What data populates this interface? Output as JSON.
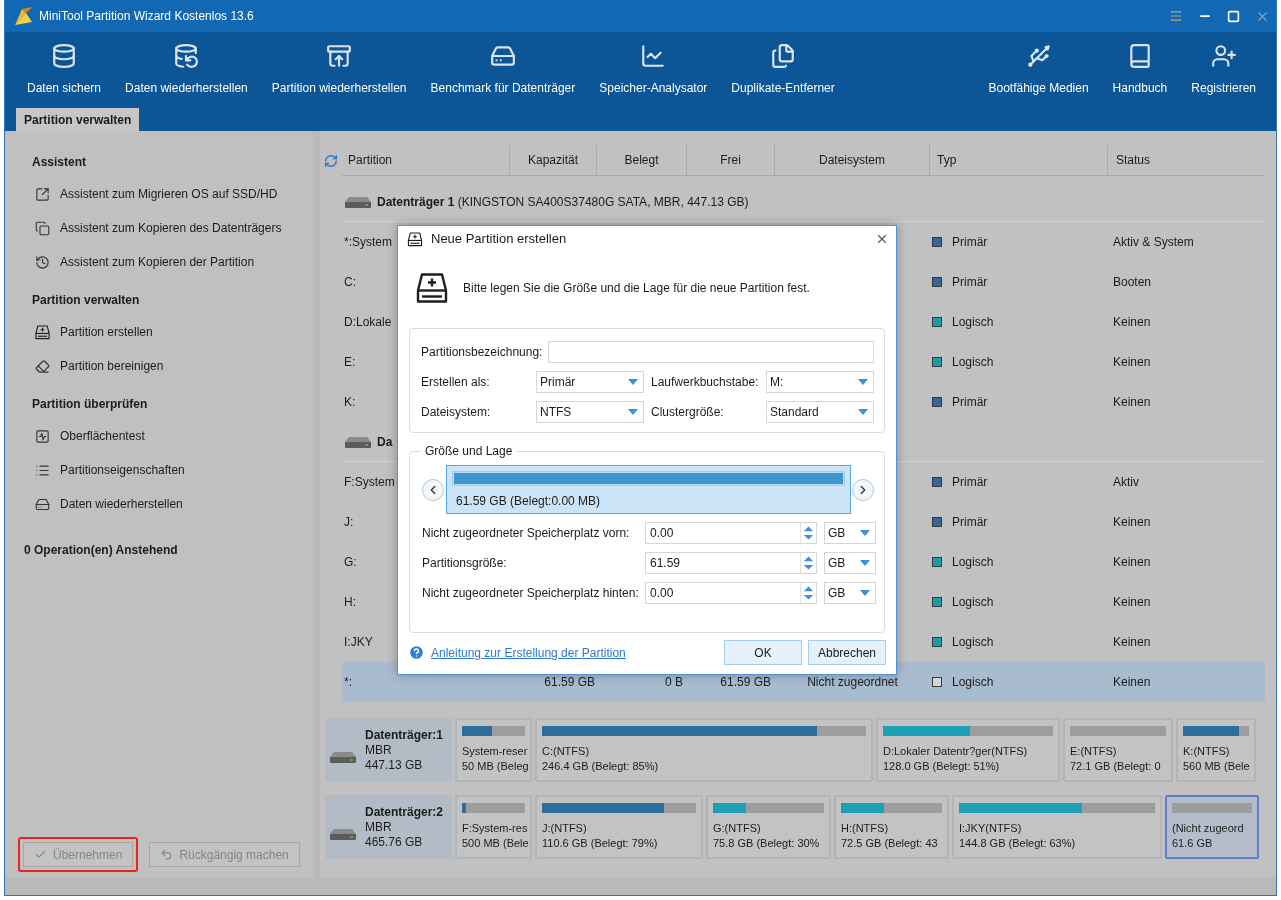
{
  "window": {
    "title": "MiniTool Partition Wizard Kostenlos 13.6"
  },
  "toolbar": {
    "left": [
      "Daten sichern",
      "Daten wiederherstellen",
      "Partition wiederherstellen",
      "Benchmark für Datenträger",
      "Speicher-Analysator",
      "Duplikate-Entferner"
    ],
    "right": [
      "Bootfähige Medien",
      "Handbuch",
      "Registrieren"
    ]
  },
  "tabs": [
    {
      "label": "Partition verwalten",
      "selected": true
    }
  ],
  "sidebar": {
    "sections": [
      {
        "title": "Assistent",
        "items": [
          "Assistent zum Migrieren OS auf SSD/HD",
          "Assistent zum Kopieren des Datenträgers",
          "Assistent zum Kopieren der Partition"
        ]
      },
      {
        "title": "Partition verwalten",
        "items": [
          "Partition erstellen",
          "Partition bereinigen"
        ]
      },
      {
        "title": "Partition überprüfen",
        "items": [
          "Oberflächentest",
          "Partitionseigenschaften",
          "Daten wiederherstellen"
        ]
      }
    ],
    "pending": "0 Operation(en) Anstehend",
    "buttons": [
      {
        "label": "Übernehmen",
        "kind": "apply",
        "disabled": true,
        "highlighted": true
      },
      {
        "label": "Rückgängig machen",
        "kind": "undo",
        "disabled": true,
        "highlighted": false
      }
    ]
  },
  "table": {
    "columns": [
      "Partition",
      "Kapazität",
      "Belegt",
      "Frei",
      "Dateisystem",
      "Typ",
      "Status"
    ],
    "disks": [
      {
        "name": "Datenträger 1",
        "details": "(KINGSTON SA400S37480G SATA, MBR, 447.13 GB)",
        "rows": [
          {
            "partition": "*:System",
            "type": "Primär",
            "status": "Aktiv & System",
            "color": "#2e6a9b",
            "selected": false
          },
          {
            "partition": "C:",
            "type": "Primär",
            "status": "Booten",
            "color": "#2e6a9b",
            "selected": false
          },
          {
            "partition": "D:Lokale",
            "type": "Logisch",
            "status": "Keinen",
            "color": "#1f9aad",
            "selected": false
          },
          {
            "partition": "E:",
            "type": "Logisch",
            "status": "Keinen",
            "color": "#1f9aad",
            "selected": false
          },
          {
            "partition": "K:",
            "type": "Primär",
            "status": "Keinen",
            "color": "#2e6a9b",
            "selected": false
          }
        ]
      },
      {
        "name": "Da",
        "rows": [
          {
            "partition": "F:System",
            "type": "Primär",
            "status": "Aktiv",
            "color": "#2e6a9b",
            "selected": false
          },
          {
            "partition": "J:",
            "type": "Primär",
            "status": "Keinen",
            "color": "#2e6a9b",
            "selected": false
          },
          {
            "partition": "G:",
            "type": "Logisch",
            "status": "Keinen",
            "color": "#1f9aad",
            "selected": false
          },
          {
            "partition": "H:",
            "type": "Logisch",
            "status": "Keinen",
            "color": "#1f9aad",
            "selected": false
          },
          {
            "partition": "I:JKY",
            "type": "Logisch",
            "status": "Keinen",
            "color": "#1f9aad",
            "selected": false
          },
          {
            "partition": "*:",
            "capacity": "61.59 GB",
            "used": "0 B",
            "free": "61.59 GB",
            "file_system": "Nicht zugeordnet",
            "type": "Logisch",
            "status": "Keinen",
            "color": "#d6d6d6",
            "selected": true
          }
        ]
      }
    ]
  },
  "disk_map": [
    {
      "name": "Datenträger:1",
      "scheme": "MBR",
      "size": "447.13 GB",
      "partitions": [
        {
          "label": "System-reser",
          "info": "50 MB (Beleg",
          "level": 0.47,
          "color": "#2e6e9e",
          "selected": false
        },
        {
          "label": "C:(NTFS)",
          "info": "246.4 GB (Belegt: 85%)",
          "level": 0.85,
          "color": "#2e6e9e",
          "selected": false
        },
        {
          "label": "D:Lokaler Datentr?ger(NTFS)",
          "info": "128.0 GB (Belegt: 51%)",
          "level": 0.51,
          "color": "#1f9fb3",
          "selected": false
        },
        {
          "label": "E:(NTFS)",
          "info": "72.1 GB (Belegt: 0",
          "selected": false
        },
        {
          "label": "K:(NTFS)",
          "info": "560 MB (Bele",
          "level": 0.85,
          "color": "#2e6e9e",
          "selected": false
        }
      ]
    },
    {
      "name": "Datenträger:2",
      "scheme": "MBR",
      "size": "465.76 GB",
      "partitions": [
        {
          "label": "F:System-res",
          "info": "500 MB (Bele",
          "level": 0.07,
          "color": "#2e6e9e",
          "selected": false
        },
        {
          "label": "J:(NTFS)",
          "info": "110.6 GB (Belegt: 79%)",
          "level": 0.79,
          "color": "#2e6e9e",
          "selected": false
        },
        {
          "label": "G:(NTFS)",
          "info": "75.8 GB (Belegt: 30%",
          "level": 0.3,
          "color": "#1f9fb3",
          "selected": false
        },
        {
          "label": "H:(NTFS)",
          "info": "72.5 GB (Belegt: 43",
          "level": 0.43,
          "color": "#1f9fb3",
          "selected": false
        },
        {
          "label": "I:JKY(NTFS)",
          "info": "144.8 GB (Belegt: 63%)",
          "level": 0.63,
          "color": "#1f9fb3",
          "selected": false
        },
        {
          "label": "(Nicht zugeord",
          "info": "61.6 GB",
          "selected": true
        }
      ]
    }
  ],
  "dialog": {
    "title": "Neue Partition erstellen",
    "instruction": "Bitte legen Sie die Größe und die Lage für die neue Partition fest.",
    "name_field": {
      "label": "Partitionsbezeichnung:"
    },
    "options": [
      {
        "label": "Erstellen als:",
        "value": "Primär"
      },
      {
        "label": "Laufwerkbuchstabe:",
        "value": "M:"
      },
      {
        "label": "Dateisystem:",
        "value": "NTFS"
      },
      {
        "label": "Clustergröße:",
        "value": "Standard"
      }
    ],
    "size_and_location": {
      "title": "Größe und Lage",
      "bar": {
        "text": "61.59 GB (Belegt:0.00 MB)",
        "level": 1
      },
      "rows": [
        {
          "label": "Nicht zugeordneter Speicherplatz vorn:",
          "value": "0.00",
          "unit": "GB"
        },
        {
          "label": "Partitionsgröße:",
          "value": "61.59",
          "unit": "GB"
        },
        {
          "label": "Nicht zugeordneter Speicherplatz hinten:",
          "value": "0.00",
          "unit": "GB"
        }
      ]
    },
    "help_link": "Anleitung zur Erstellung der Partition",
    "buttons": [
      "OK",
      "Abbrechen"
    ]
  }
}
